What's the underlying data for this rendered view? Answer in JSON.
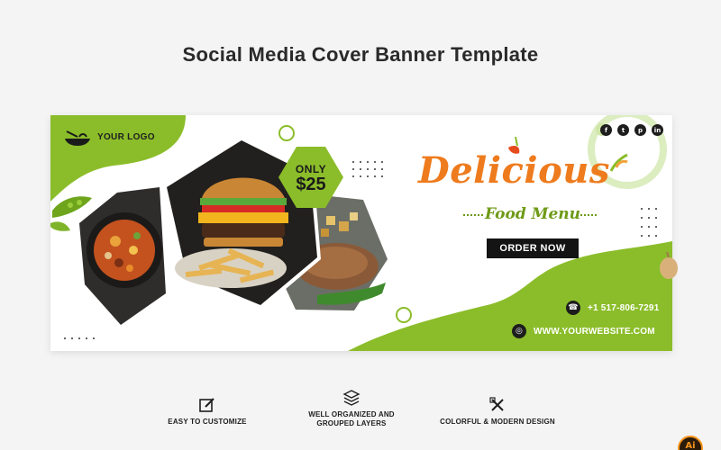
{
  "page": {
    "title": "Social Media Cover Banner Template"
  },
  "banner": {
    "logo_text": "YOUR LOGO",
    "price_only": "ONLY",
    "price_value": "$25",
    "headline": "Delicious",
    "subhead": "Food Menu",
    "order_button": "ORDER NOW",
    "phone": "+1 517-806-7291",
    "website": "WWW.YOURWEBSITE.COM",
    "social_icons": [
      "facebook-icon",
      "twitter-icon",
      "pinterest-icon",
      "linkedin-icon"
    ],
    "social_glyphs": {
      "facebook": "f",
      "twitter": "t",
      "pinterest": "p",
      "linkedin": "in"
    },
    "photos": [
      "paella",
      "burger-and-fries",
      "grilled-meat"
    ]
  },
  "features": [
    {
      "icon": "edit-icon",
      "label": "EASY TO CUSTOMIZE"
    },
    {
      "icon": "layers-icon",
      "label": "WELL ORGANIZED AND GROUPED LAYERS"
    },
    {
      "icon": "design-tools-icon",
      "label": "COLORFUL & MODERN DESIGN"
    }
  ],
  "badge": "Ai",
  "colors": {
    "accent_green": "#8bbd2a",
    "accent_orange": "#ee7b1d",
    "dark": "#141414",
    "page_bg": "#f4f4f4"
  }
}
